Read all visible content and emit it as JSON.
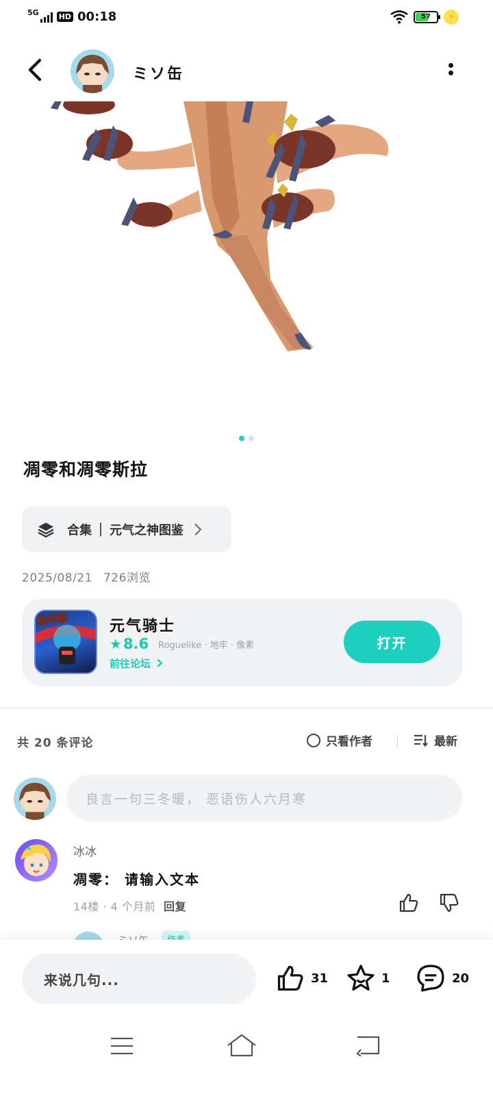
{
  "status_bar": {
    "network": "5G",
    "hd_label": "HD",
    "time": "00:18",
    "battery": "57",
    "battery_level": 0.57
  },
  "header": {
    "author_name": "ミソ缶",
    "back_icon": "back-arrow-icon",
    "more_icon": "more-vertical-icon"
  },
  "post": {
    "image_count": 2,
    "active_image": 1,
    "title": "凋零和凋零斯拉",
    "collection_label": "合集",
    "collection_name": "元气之神图鉴",
    "date": "2025/08/21",
    "views": "726浏览"
  },
  "game_card": {
    "name": "元气骑士",
    "badge_text": "机甲版",
    "score": "8.6",
    "tags": "Roguelike · 地牢 · 像素",
    "forum_link": "前往论坛",
    "open_button": "打开"
  },
  "comments": {
    "count_text": "共 20 条评论",
    "author_only": "只看作者",
    "sort": "最新",
    "input_placeholder": "良言一句三冬暖， 恶语伤人六月寒",
    "items": [
      {
        "user": "冰冰",
        "text": "凋零： 请输入文本",
        "floor": "14楼",
        "time": "4 个月前",
        "reply": "回复"
      }
    ],
    "peek_user": "ミソ缶",
    "peek_badge": "作者"
  },
  "bottom_bar": {
    "input_placeholder": "来说几句...",
    "likes": "31",
    "favorites": "1",
    "comments": "20"
  },
  "colors": {
    "accent": "#1ccfbf",
    "card_bg": "#f2f3f5",
    "text_primary": "#111111",
    "text_muted": "#9aa0a8"
  }
}
